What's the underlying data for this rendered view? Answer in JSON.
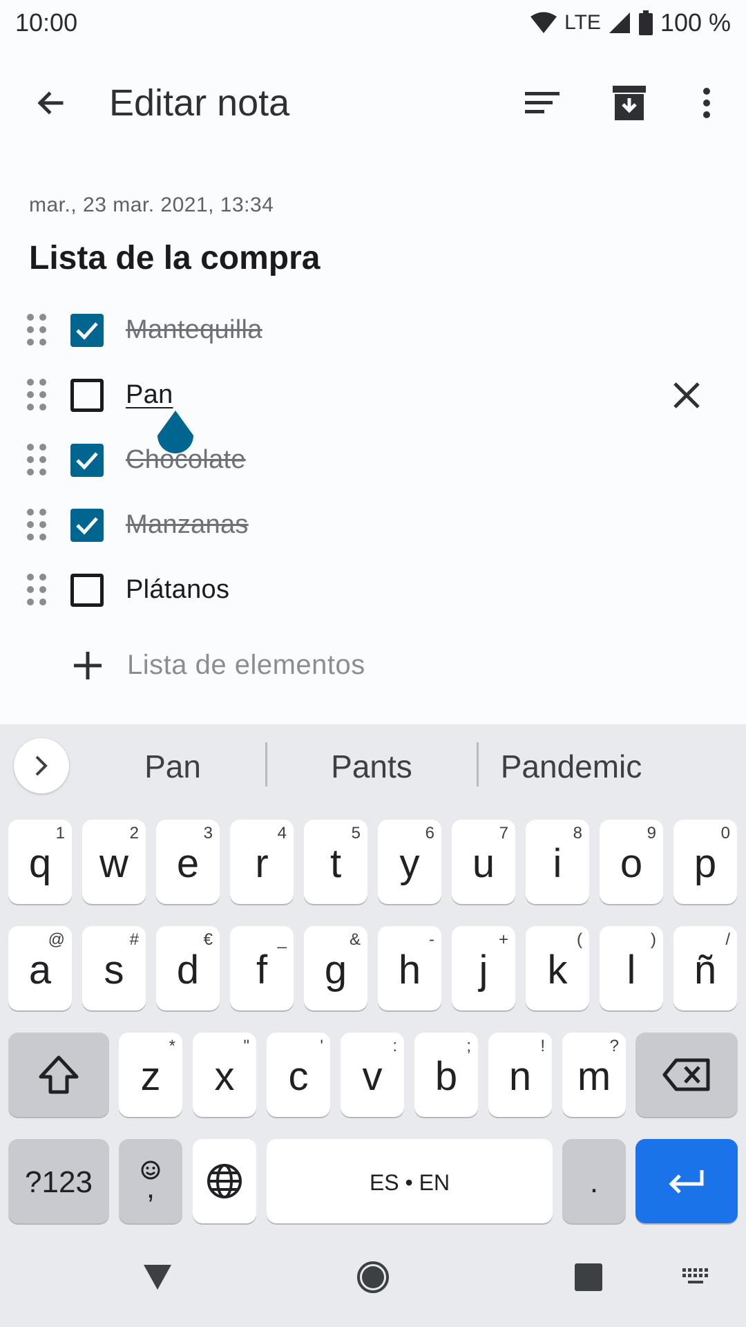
{
  "status_bar": {
    "time": "10:00",
    "network": "LTE",
    "battery": "100 %"
  },
  "app_bar": {
    "title": "Editar nota",
    "icons": [
      "back-arrow-icon",
      "sort-icon",
      "archive-icon",
      "more-vert-icon"
    ]
  },
  "note": {
    "date": "mar., 23 mar. 2021, 13:34",
    "title": "Lista de la compra",
    "items": [
      {
        "label": "Mantequilla",
        "checked": true
      },
      {
        "label": "Pan",
        "checked": false
      },
      {
        "label": "Chocolate",
        "checked": true
      },
      {
        "label": "Manzanas",
        "checked": true
      },
      {
        "label": "Plátanos",
        "checked": false
      }
    ],
    "add_item_placeholder": "Lista de elementos"
  },
  "colors": {
    "accent": "#00658f",
    "keyboard_action": "#1a73e8",
    "keyboard_bg": "#e8eaed"
  },
  "keyboard": {
    "suggestions": [
      "Pan",
      "Pants",
      "Pandemic"
    ],
    "row1": [
      {
        "k": "q",
        "h": "1"
      },
      {
        "k": "w",
        "h": "2"
      },
      {
        "k": "e",
        "h": "3"
      },
      {
        "k": "r",
        "h": "4"
      },
      {
        "k": "t",
        "h": "5"
      },
      {
        "k": "y",
        "h": "6"
      },
      {
        "k": "u",
        "h": "7"
      },
      {
        "k": "i",
        "h": "8"
      },
      {
        "k": "o",
        "h": "9"
      },
      {
        "k": "p",
        "h": "0"
      }
    ],
    "row2": [
      {
        "k": "a",
        "h": "@"
      },
      {
        "k": "s",
        "h": "#"
      },
      {
        "k": "d",
        "h": "€"
      },
      {
        "k": "f",
        "h": "_"
      },
      {
        "k": "g",
        "h": "&"
      },
      {
        "k": "h",
        "h": "-"
      },
      {
        "k": "j",
        "h": "+"
      },
      {
        "k": "k",
        "h": "("
      },
      {
        "k": "l",
        "h": ")"
      },
      {
        "k": "ñ",
        "h": "/"
      }
    ],
    "row3": [
      {
        "k": "z",
        "h": "*"
      },
      {
        "k": "x",
        "h": "\""
      },
      {
        "k": "c",
        "h": "'"
      },
      {
        "k": "v",
        "h": ":"
      },
      {
        "k": "b",
        "h": ";"
      },
      {
        "k": "n",
        "h": "!"
      },
      {
        "k": "m",
        "h": "?"
      }
    ],
    "symbols_key": "?123",
    "comma_key": ",",
    "space_label": "ES • EN",
    "period_key": "."
  }
}
